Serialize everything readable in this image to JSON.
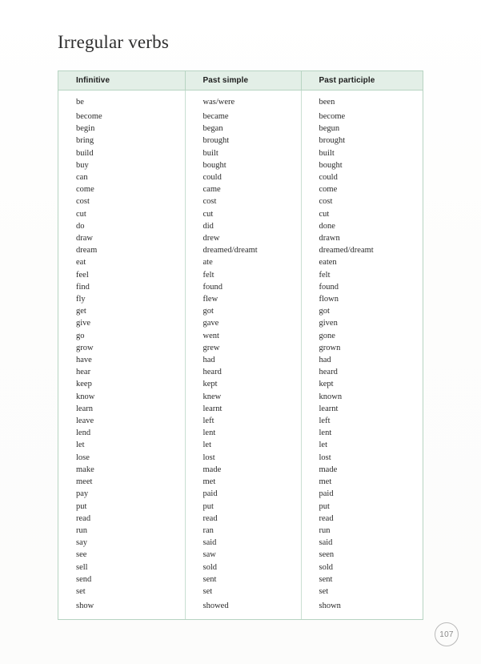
{
  "document": {
    "title": "Irregular verbs",
    "page_number": "107"
  },
  "table": {
    "headers": [
      "Infinitive",
      "Past simple",
      "Past participle"
    ],
    "rows": [
      [
        "be",
        "was/were",
        "been"
      ],
      [
        "become",
        "became",
        "become"
      ],
      [
        "begin",
        "began",
        "begun"
      ],
      [
        "bring",
        "brought",
        "brought"
      ],
      [
        "build",
        "built",
        "built"
      ],
      [
        "buy",
        "bought",
        "bought"
      ],
      [
        "can",
        "could",
        "could"
      ],
      [
        "come",
        "came",
        "come"
      ],
      [
        "cost",
        "cost",
        "cost"
      ],
      [
        "cut",
        "cut",
        "cut"
      ],
      [
        "do",
        "did",
        "done"
      ],
      [
        "draw",
        "drew",
        "drawn"
      ],
      [
        "dream",
        "dreamed/dreamt",
        "dreamed/dreamt"
      ],
      [
        "eat",
        "ate",
        "eaten"
      ],
      [
        "feel",
        "felt",
        "felt"
      ],
      [
        "find",
        "found",
        "found"
      ],
      [
        "fly",
        "flew",
        "flown"
      ],
      [
        "get",
        "got",
        "got"
      ],
      [
        "give",
        "gave",
        "given"
      ],
      [
        "go",
        "went",
        "gone"
      ],
      [
        "grow",
        "grew",
        "grown"
      ],
      [
        "have",
        "had",
        "had"
      ],
      [
        "hear",
        "heard",
        "heard"
      ],
      [
        "keep",
        "kept",
        "kept"
      ],
      [
        "know",
        "knew",
        "known"
      ],
      [
        "learn",
        "learnt",
        "learnt"
      ],
      [
        "leave",
        "left",
        "left"
      ],
      [
        "lend",
        "lent",
        "lent"
      ],
      [
        "let",
        "let",
        "let"
      ],
      [
        "lose",
        "lost",
        "lost"
      ],
      [
        "make",
        "made",
        "made"
      ],
      [
        "meet",
        "met",
        "met"
      ],
      [
        "pay",
        "paid",
        "paid"
      ],
      [
        "put",
        "put",
        "put"
      ],
      [
        "read",
        "read",
        "read"
      ],
      [
        "run",
        "ran",
        "run"
      ],
      [
        "say",
        "said",
        "said"
      ],
      [
        "see",
        "saw",
        "seen"
      ],
      [
        "sell",
        "sold",
        "sold"
      ],
      [
        "send",
        "sent",
        "sent"
      ],
      [
        "set",
        "set",
        "set"
      ],
      [
        "show",
        "showed",
        "shown"
      ]
    ]
  },
  "colors": {
    "header_background": "#e3efe7",
    "border": "#b7d4c2",
    "text": "#2b2b2b",
    "page_number": "#8a8a8a"
  }
}
